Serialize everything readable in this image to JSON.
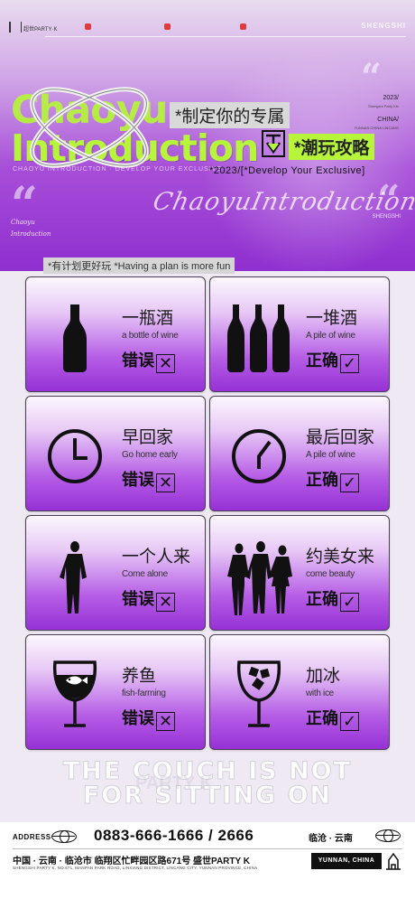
{
  "topbar": {
    "left_text": "超世PARTY·K",
    "chip_1": "",
    "chip_2": "",
    "chip_3": "",
    "right_text": "SHENGSHI"
  },
  "hero": {
    "title_line1": "Chaoyu",
    "title_line2": "Introduction",
    "tag_1": "*制定你的专属",
    "tag_2": "*潮玩攻略",
    "year": "2023/",
    "small_side": "Shengshi Party Ktv",
    "country": "CHINA/",
    "country_sub": "YUNNAN CHINA·LINCANG",
    "sub_line": "CHAOYU INTRODUCTION · DEVELOP YOUR EXCLUSIVE",
    "develop_line": "*2023/[*Develop Your Exclusive]",
    "script_big": "ChaoyuIntroduction",
    "script_small_1": "Chaoyu",
    "script_small_2": "Introduction",
    "script_tiny": "SHENGSHI"
  },
  "plan_bar": "*有计划更好玩  *Having a plan is more fun",
  "cards": [
    {
      "cn": "一瓶酒",
      "en": "a bottle of wine",
      "verdict": "错误",
      "mark": "☒",
      "icon": "wine-bottle-icon"
    },
    {
      "cn": "一堆酒",
      "en": "A pile of wine",
      "verdict": "正确",
      "mark": "☑",
      "icon": "three-bottles-icon"
    },
    {
      "cn": "早回家",
      "en": "Go home early",
      "verdict": "错误",
      "mark": "☒",
      "icon": "clock-early-icon"
    },
    {
      "cn": "最后回家",
      "en": "A pile of wine",
      "verdict": "正确",
      "mark": "☑",
      "icon": "clock-late-icon"
    },
    {
      "cn": "一个人来",
      "en": "Come alone",
      "verdict": "错误",
      "mark": "☒",
      "icon": "single-person-icon"
    },
    {
      "cn": "约美女来",
      "en": "come beauty",
      "verdict": "正确",
      "mark": "☑",
      "icon": "group-people-icon"
    },
    {
      "cn": "养鱼",
      "en": "fish-farming",
      "verdict": "错误",
      "mark": "☒",
      "icon": "wine-glass-fish-icon"
    },
    {
      "cn": "加冰",
      "en": "with ice",
      "verdict": "正确",
      "mark": "☑",
      "icon": "wine-glass-ice-icon"
    }
  ],
  "watermark": {
    "line1": "THE COUCH IS NOT",
    "line2": "FOR SITTING ON",
    "mid": "PARTY K"
  },
  "footer": {
    "address_label": "ADDRESS",
    "phone": "0883-666-1666 / 2666",
    "city": "临沧 · 云南",
    "address_cn": "中国 · 云南 · 临沧市  临翔区忙畔园区路671号  盛世PARTY K",
    "address_en": "SHENGSHI PARTY K, NO.671, MANPAN PARK ROAD, LINXIANG DISTRICT, LINCANG CITY, YUNNAN PROVINCE, CHINA",
    "tag": "YUNNAN, CHINA"
  },
  "colors": {
    "accent_green": "#b6f53a",
    "purple": "#9631d6"
  }
}
